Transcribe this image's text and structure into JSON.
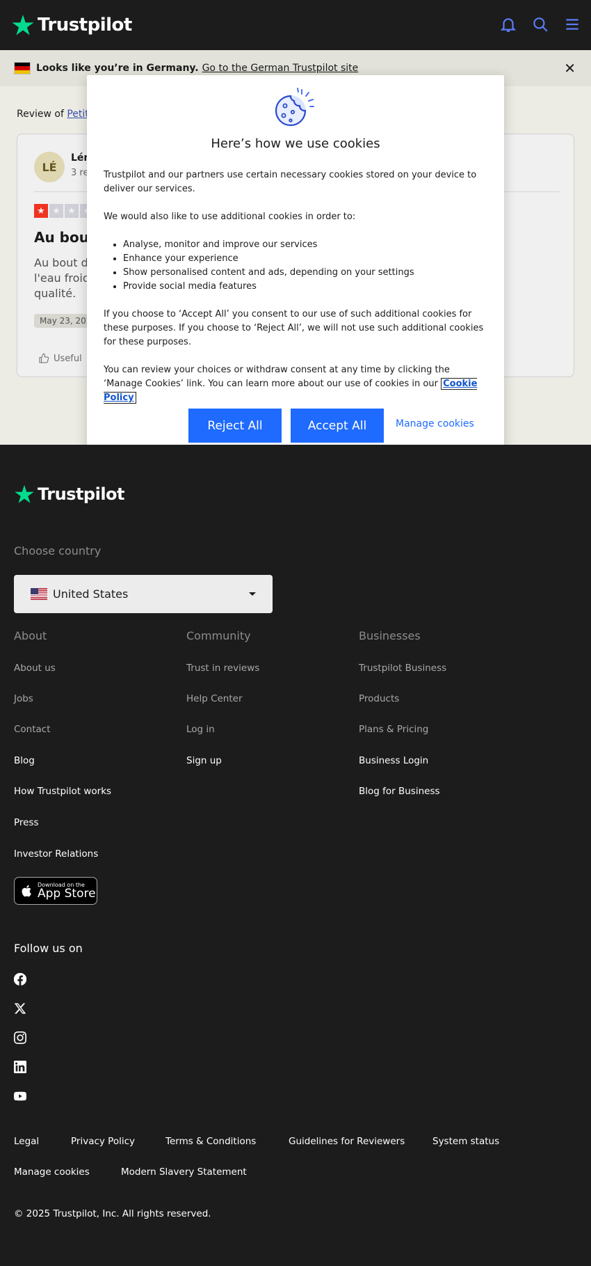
{
  "header": {
    "logo": "Trustpilot",
    "icons": [
      "bell-icon",
      "search-icon",
      "menu-icon"
    ],
    "brand_green": "#04da8d",
    "icon_color": "#5c7cfa"
  },
  "banner": {
    "message": "Looks like you’re in Germany.",
    "link": "Go to the German Trustpilot site"
  },
  "review": {
    "review_of_label": "Review of",
    "company": "Petite",
    "avatar_initials": "LÉ",
    "reviewer_name": "Lén",
    "reviews_count": "3 re",
    "rating": 1,
    "max_rating": 5,
    "title": "Au bout c",
    "body": "Au bout de\nl'eau froide\nqualité.",
    "date": "May 23, 202",
    "useful_label": "Useful"
  },
  "cookie_modal": {
    "title": "Here’s how we use cookies",
    "p1": "Trustpilot and our partners use certain necessary cookies stored on your device to deliver our services.",
    "p2": "We would also like to use additional cookies in order to:",
    "list": [
      "Analyse, monitor and improve our services",
      "Enhance your experience",
      "Show personalised content and ads, depending on your settings",
      "Provide social media features"
    ],
    "p3": "If you choose to ‘Accept All’ you consent to our use of such additional cookies for these purposes. If you choose to ‘Reject All’, we will not use such additional cookies for these purposes.",
    "p4": "You can review your choices or withdraw consent at any time by clicking the ‘Manage Cookies’ link. You can learn more about our use of cookies in our",
    "policy_link": "Cookie Policy",
    "reject_label": "Reject All",
    "accept_label": "Accept All",
    "manage_label": "Manage cookies",
    "button_color": "#1f6aff"
  },
  "footer": {
    "logo": "Trustpilot",
    "choose_country": "Choose country",
    "country": "United States",
    "columns": [
      {
        "heading": "About",
        "links": [
          "About us",
          "Jobs",
          "Contact",
          "Blog",
          "How Trustpilot works",
          "Press",
          "Investor Relations"
        ]
      },
      {
        "heading": "Community",
        "links": [
          "Trust in reviews",
          "Help Center",
          "Log in",
          "Sign up"
        ]
      },
      {
        "heading": "Businesses",
        "links": [
          "Trustpilot Business",
          "Products",
          "Plans & Pricing",
          "Business Login",
          "Blog for Business"
        ]
      }
    ],
    "app_store_small": "Download on the",
    "app_store_big": "App Store",
    "follow_us": "Follow us on",
    "social": [
      "facebook-icon",
      "x-icon",
      "instagram-icon",
      "linkedin-icon",
      "youtube-icon"
    ],
    "legal_links": [
      "Legal",
      "Privacy Policy",
      "Terms & Conditions",
      "Guidelines for Reviewers",
      "System status",
      "Manage cookies",
      "Modern Slavery Statement"
    ],
    "copyright": "© 2025 Trustpilot, Inc. All rights reserved."
  }
}
